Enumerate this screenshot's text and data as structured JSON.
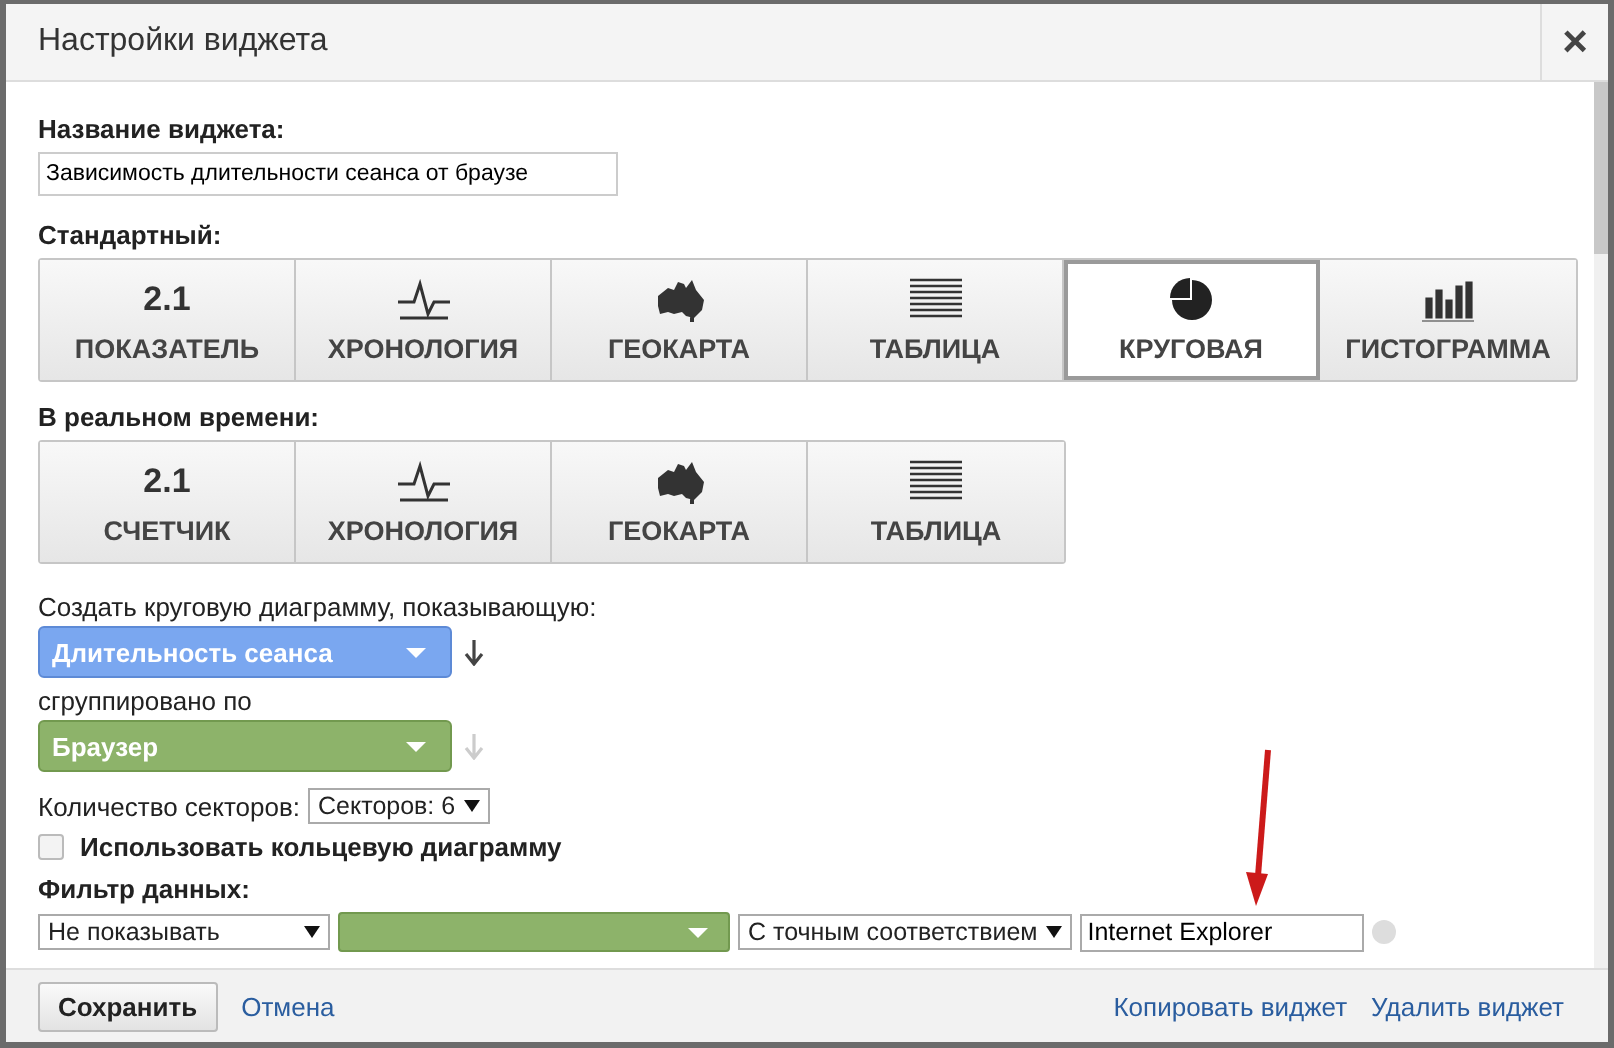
{
  "window": {
    "title": "Настройки виджета",
    "close": "×"
  },
  "name_field": {
    "label": "Название виджета:",
    "value": "Зависимость длительности сеанса от браузе"
  },
  "standard": {
    "label": "Стандартный:",
    "buttons": [
      {
        "kind": "number",
        "icon_text": "2.1",
        "label": "ПОКАЗАТЕЛЬ",
        "selected": false
      },
      {
        "kind": "timeline",
        "label": "ХРОНОЛОГИЯ",
        "selected": false
      },
      {
        "kind": "geo",
        "label": "ГЕОКАРТА",
        "selected": false
      },
      {
        "kind": "table",
        "label": "ТАБЛИЦА",
        "selected": false
      },
      {
        "kind": "pie",
        "label": "КРУГОВАЯ",
        "selected": true
      },
      {
        "kind": "bar",
        "label": "ГИСТОГРАММА",
        "selected": false
      }
    ]
  },
  "realtime": {
    "label": "В реальном времени:",
    "buttons": [
      {
        "kind": "number",
        "icon_text": "2.1",
        "label": "СЧЕТЧИК",
        "selected": false
      },
      {
        "kind": "timeline",
        "label": "ХРОНОЛОГИЯ",
        "selected": false
      },
      {
        "kind": "geo",
        "label": "ГЕОКАРТА",
        "selected": false
      },
      {
        "kind": "table",
        "label": "ТАБЛИЦА",
        "selected": false
      }
    ]
  },
  "selectors": [
    {
      "label": "Создать круговую диаграмму, показывающую:",
      "kind": "metric",
      "value": "Длительность сеанса",
      "sort_enabled": true
    },
    {
      "label": "сгруппировано по",
      "kind": "dimension",
      "value": "Браузер",
      "sort_enabled": false
    }
  ],
  "slices": {
    "label": "Количество секторов:",
    "value": "Секторов: 6"
  },
  "donut": {
    "label": "Использовать кольцевую диаграмму",
    "checked": false
  },
  "filter": {
    "label": "Фильтр данных:",
    "mode": "Не показывать",
    "match": "С точным соответствием",
    "value": "Internet Explorer"
  },
  "footer": {
    "save": "Сохранить",
    "cancel": "Отмена",
    "copy": "Копировать виджет",
    "delete": "Удалить виджет"
  }
}
